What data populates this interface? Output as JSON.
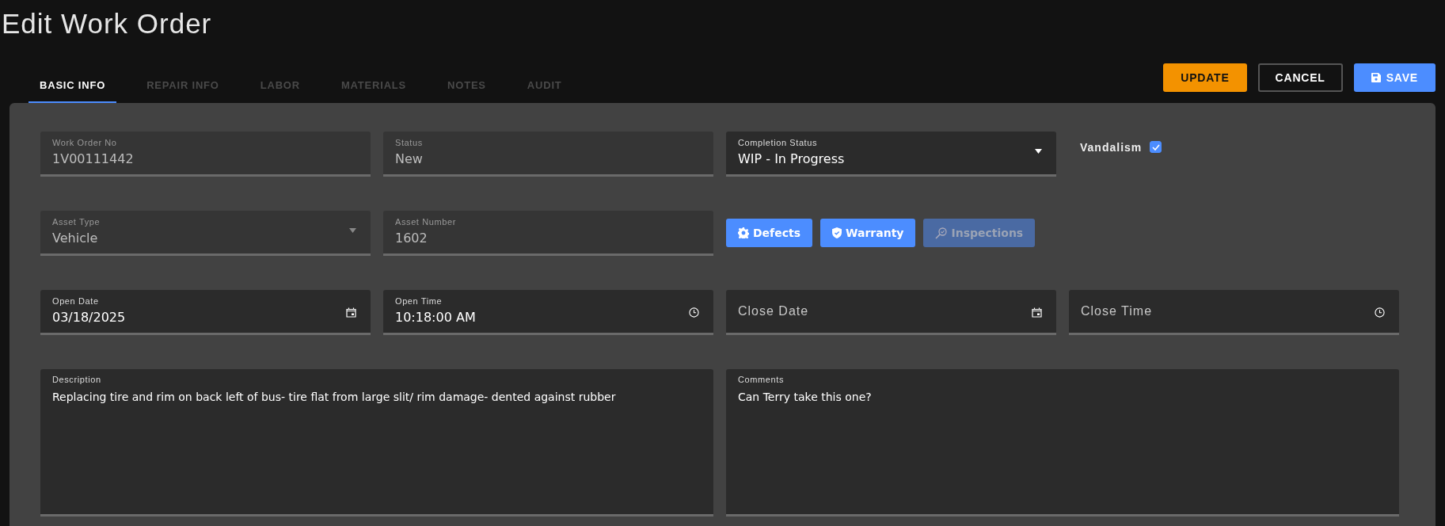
{
  "page": {
    "title": "Edit Work Order"
  },
  "tabs": [
    {
      "label": "BASIC INFO",
      "selected": true
    },
    {
      "label": "REPAIR INFO",
      "selected": false
    },
    {
      "label": "LABOR",
      "selected": false
    },
    {
      "label": "MATERIALS",
      "selected": false
    },
    {
      "label": "NOTES",
      "selected": false
    },
    {
      "label": "AUDIT",
      "selected": false
    }
  ],
  "actions": [
    {
      "label": "UPDATE",
      "kind": "warning"
    },
    {
      "label": "CANCEL",
      "kind": "outline"
    },
    {
      "label": "SAVE",
      "kind": "save"
    }
  ],
  "row_1": {
    "fields": [
      {
        "label": "Work Order No",
        "value": "1V00111442",
        "kind": "text",
        "disabled": true
      },
      {
        "label": "Status",
        "value": "New",
        "kind": "text",
        "disabled": true
      },
      {
        "label": "Completion Status",
        "value": "WIP - In Progress",
        "kind": "select",
        "disabled": false
      }
    ],
    "vandalism": {
      "label": "Vandalism",
      "checked": true
    }
  },
  "row_2": {
    "fields": [
      {
        "label": "Asset Type",
        "value": "Vehicle",
        "kind": "select",
        "disabled": true
      },
      {
        "label": "Asset Number",
        "value": "1602",
        "kind": "text",
        "disabled": true
      }
    ],
    "buttons": [
      {
        "label": "Defects",
        "kind": "defects",
        "disabled": false
      },
      {
        "label": "Warranty",
        "kind": "warranty",
        "disabled": false
      },
      {
        "label": "Inspections",
        "kind": "inspections",
        "disabled": true
      }
    ]
  },
  "row_3": {
    "fields": [
      {
        "label": "Open Date",
        "value": "03/18/2025",
        "kind": "date",
        "disabled": false
      },
      {
        "label": "Open Time",
        "value": "10:18:00 AM",
        "kind": "time",
        "disabled": false
      },
      {
        "label": "Close Date",
        "kind": "date",
        "disabled": false
      },
      {
        "label": "Close Time",
        "kind": "time",
        "disabled": false
      }
    ]
  },
  "notes": [
    {
      "label": "Description",
      "value": "Replacing tire and rim on back left of bus- tire flat from large slit/ rim damage- dented against rubber"
    },
    {
      "label": "Comments",
      "value": "Can Terry take this one?"
    }
  ]
}
